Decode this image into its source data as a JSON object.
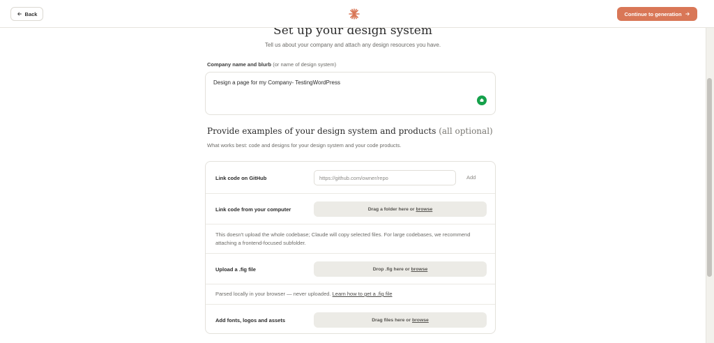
{
  "header": {
    "back_label": "Back",
    "continue_label": "Continue to generation",
    "accent_color": "#d97757"
  },
  "page": {
    "title": "Set up your design system",
    "subtitle": "Tell us about your company and attach any design resources you have."
  },
  "company": {
    "label": "Company name and blurb",
    "label_hint": "(or name of design system)",
    "value": "Design a page for my Company- TestingWordPress"
  },
  "examples": {
    "title": "Provide examples of your design system and products",
    "title_hint": "(all optional)",
    "subtitle": "What works best: code and designs for your design system and your code products."
  },
  "github": {
    "label": "Link code on GitHub",
    "placeholder": "https://github.com/owner/repo",
    "add_label": "Add"
  },
  "local_code": {
    "label": "Link code from your computer",
    "drop_text": "Drag a folder here or",
    "browse_label": "browse",
    "note": "This doesn't upload the whole codebase; Claude will copy selected files. For large codebases, we recommend attaching a frontend-focused subfolder."
  },
  "fig": {
    "label": "Upload a .fig file",
    "drop_text": "Drop .fig here or",
    "browse_label": "browse",
    "note": "Parsed locally in your browser — never uploaded.",
    "help_link": "Learn how to get a .fig file"
  },
  "assets": {
    "label": "Add fonts, logos and assets",
    "drop_text": "Drag files here or",
    "browse_label": "browse"
  },
  "icons": {
    "back": "arrow-left-icon",
    "logo": "claude-asterisk-logo",
    "continue": "arrow-right-icon",
    "grammarly": "grammarly-icon"
  }
}
